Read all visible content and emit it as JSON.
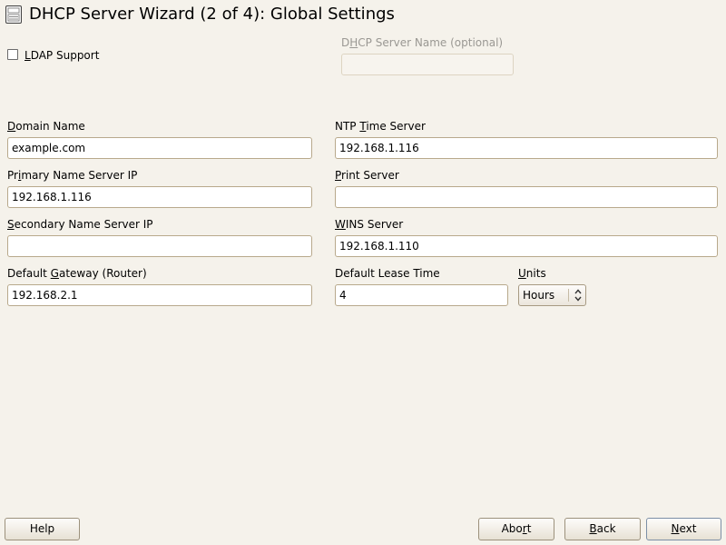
{
  "window": {
    "title": "DHCP Server Wizard (2 of 4): Global Settings",
    "icon": "server-config-icon"
  },
  "ldap": {
    "label_first": "L",
    "label_rest": "DAP Support",
    "checked": false
  },
  "server_name": {
    "label_a": "D",
    "label_u": "H",
    "label_b": "CP Server Name (optional)",
    "value": "",
    "enabled": false
  },
  "left": {
    "domain": {
      "label_u": "D",
      "label_rest": "omain Name",
      "value": "example.com"
    },
    "primary": {
      "label_a": "Pr",
      "label_u": "i",
      "label_b": "mary Name Server IP",
      "value": "192.168.1.116"
    },
    "secondary": {
      "label_u": "S",
      "label_rest": "econdary Name Server IP",
      "value": ""
    },
    "gateway": {
      "label_a": "Default ",
      "label_u": "G",
      "label_b": "ateway (Router)",
      "value": "192.168.2.1"
    }
  },
  "right": {
    "ntp": {
      "label_a": "NTP ",
      "label_u": "T",
      "label_b": "ime Server",
      "value": "192.168.1.116"
    },
    "print": {
      "label_u": "P",
      "label_rest": "rint Server",
      "value": ""
    },
    "wins": {
      "label_u": "W",
      "label_rest": "INS Server",
      "value": "192.168.1.110"
    },
    "lease": {
      "label": "Default Lease Time",
      "value": "4"
    },
    "units": {
      "label_u": "U",
      "label_rest": "nits",
      "selected": "Hours"
    }
  },
  "buttons": {
    "help": "Help",
    "abort": {
      "a": "Abo",
      "u": "r",
      "b": "t"
    },
    "back": {
      "u": "B",
      "rest": "ack"
    },
    "next": {
      "u": "N",
      "rest": "ext"
    }
  }
}
